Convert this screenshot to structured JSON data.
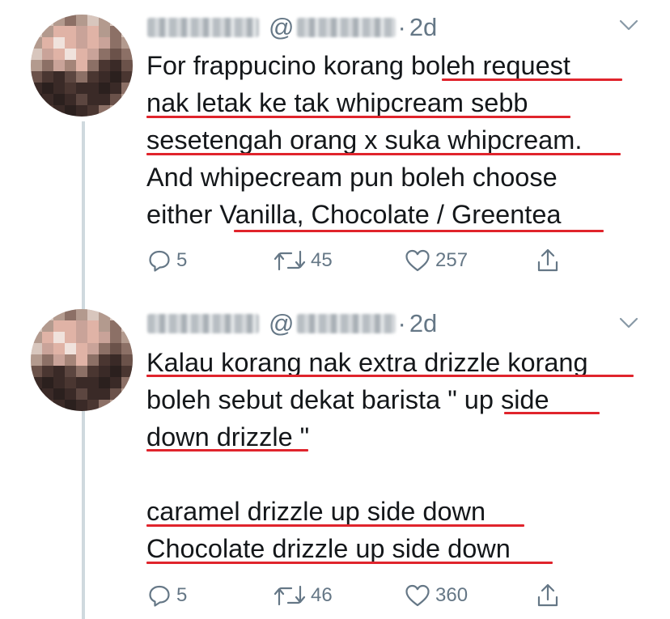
{
  "tweets": [
    {
      "at_symbol": "@",
      "time": "2d",
      "text": "For frappucino korang boleh request\nnak letak ke tak whipcream sebb\nsesetengah orang x suka whipcream.\nAnd whipecream pun boleh choose\neither Vanilla, Chocolate / Greentea",
      "actions": {
        "reply": "5",
        "retweet": "45",
        "like": "257"
      }
    },
    {
      "at_symbol": "@",
      "time": "2d",
      "text": "Kalau korang nak extra drizzle korang\nboleh sebut dekat barista \" up side\ndown drizzle \"\n\ncaramel drizzle up side down\nChocolate drizzle up side down",
      "actions": {
        "reply": "5",
        "retweet": "46",
        "like": "360"
      }
    }
  ],
  "colors": {
    "text": "#14171a",
    "secondary": "#657786",
    "underline": "#e0242c",
    "thread": "#cfd9de"
  },
  "icons": {
    "reply": "reply-icon",
    "retweet": "retweet-icon",
    "like": "heart-icon",
    "share": "share-icon",
    "menu": "chevron-down-icon"
  }
}
